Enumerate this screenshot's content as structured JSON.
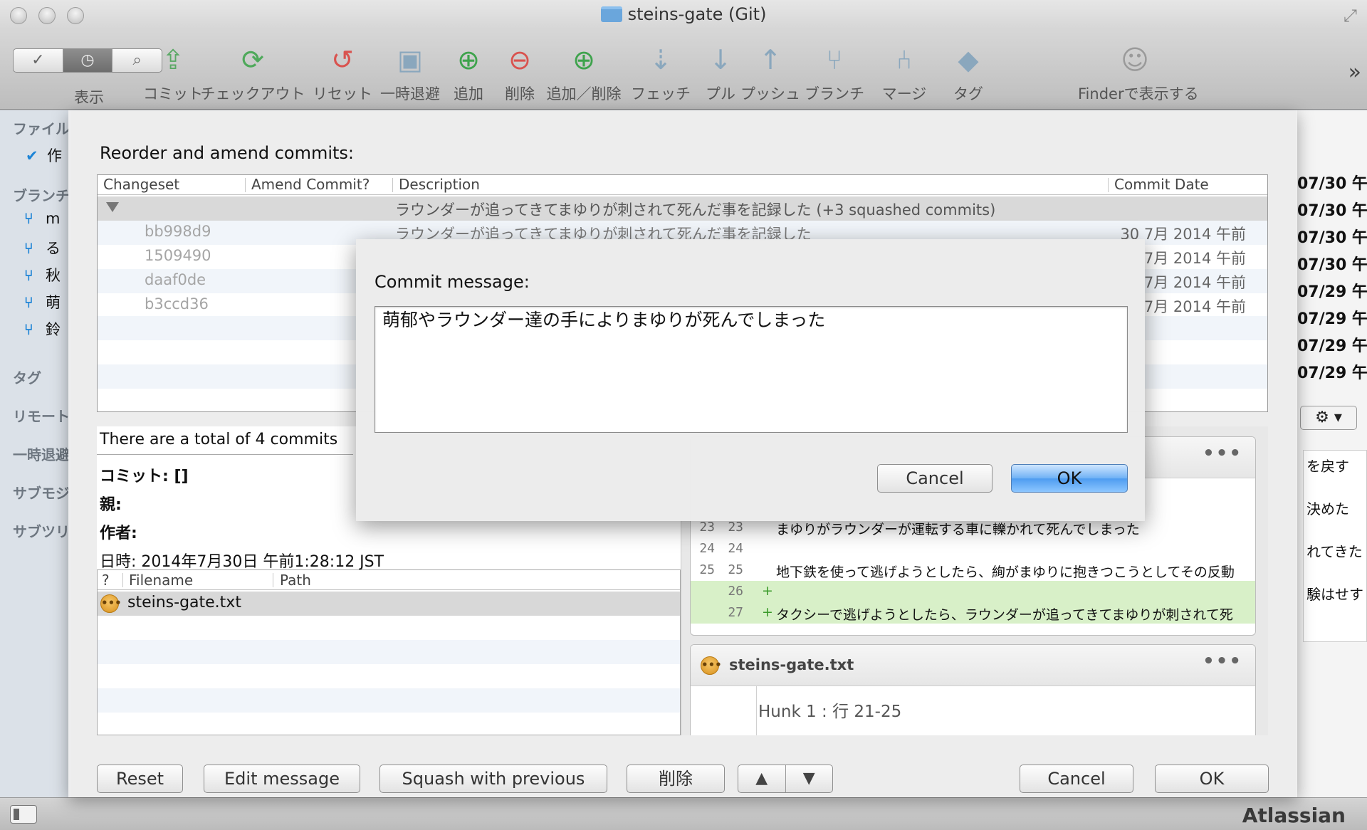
{
  "window": {
    "title": "steins-gate (Git)"
  },
  "toolbar": {
    "view_label": "表示",
    "items": [
      {
        "label": "コミット",
        "icon": "commit-icon",
        "glyph": "⇪",
        "color": "#5aa865"
      },
      {
        "label": "チェックアウト",
        "icon": "checkout-icon",
        "glyph": "⟳",
        "color": "#4fa95b"
      },
      {
        "label": "リセット",
        "icon": "reset-icon",
        "glyph": "↺",
        "color": "#d9534f"
      },
      {
        "label": "一時退避",
        "icon": "stash-icon",
        "glyph": "▣",
        "color": "#8aa7bd"
      },
      {
        "label": "追加",
        "icon": "add-icon",
        "glyph": "⊕",
        "color": "#3fa34d"
      },
      {
        "label": "削除",
        "icon": "remove-icon",
        "glyph": "⊖",
        "color": "#d9534f"
      },
      {
        "label": "追加／削除",
        "icon": "add-remove-icon",
        "glyph": "⊕",
        "color": "#3fa34d"
      },
      {
        "label": "フェッチ",
        "icon": "fetch-icon",
        "glyph": "⇣",
        "color": "#8aa7bd"
      },
      {
        "label": "プル",
        "icon": "pull-icon",
        "glyph": "↓",
        "color": "#8aa7bd"
      },
      {
        "label": "プッシュ",
        "icon": "push-icon",
        "glyph": "↑",
        "color": "#8aa7bd"
      },
      {
        "label": "ブランチ",
        "icon": "branch-icon",
        "glyph": "⑂",
        "color": "#8aa7bd"
      },
      {
        "label": "マージ",
        "icon": "merge-icon",
        "glyph": "⑃",
        "color": "#8aa7bd"
      },
      {
        "label": "タグ",
        "icon": "tag-icon",
        "glyph": "◆",
        "color": "#8aa7bd"
      },
      {
        "label": "Finderで表示する",
        "icon": "finder-icon",
        "glyph": "☺",
        "color": "#9a9a9a"
      }
    ]
  },
  "sidebar": {
    "file_header": "ファイル",
    "file_item": "作",
    "branches_header": "ブランチ",
    "branches": [
      "m",
      "る",
      "秋",
      "萌",
      "鈴"
    ],
    "tags_header": "タグ",
    "remotes_header": "リモート",
    "stash_header": "一時退避",
    "submodules_header": "サブモジ",
    "subtrees_header": "サブツリ"
  },
  "background_right": {
    "dates": [
      "07/30 午",
      "07/30 午",
      "07/30 午",
      "07/30 午",
      "07/29 午",
      "07/29 午",
      "07/29 午",
      "07/29 午"
    ],
    "text_lines": [
      "を戻す",
      "決めた",
      "れてきた",
      "験はせす"
    ]
  },
  "sheet": {
    "title": "Reorder and amend commits:",
    "columns": {
      "changeset": "Changeset",
      "amend": "Amend Commit?",
      "description": "Description",
      "date": "Commit Date"
    },
    "group_row": "ラウンダーが追ってきてまゆりが刺されて死んだ事を記録した (+3 squashed commits)",
    "commits": [
      {
        "hash": "bb998d9",
        "description": "ラウンダーが追ってきてまゆりが刺されて死んだ事を記録した",
        "date": "30 7月 2014 午前"
      },
      {
        "hash": "1509490",
        "description": "",
        "date": "7月 2014 午前"
      },
      {
        "hash": "daaf0de",
        "description": "",
        "date": "7月 2014 午前"
      },
      {
        "hash": "b3ccd36",
        "description": "",
        "date": "7月 2014 午前"
      }
    ],
    "summary_line": "There are a total of 4 commits",
    "meta": {
      "commit": "コミット: []",
      "parent": "親:",
      "author": "作者:",
      "date": "日時: 2014年7月30日 午前1:28:12 JST"
    },
    "files_columns": {
      "status": "?",
      "filename": "Filename",
      "path": "Path"
    },
    "files": [
      {
        "name": "steins-gate.txt"
      }
    ],
    "diff": {
      "card1_lines": [
        {
          "old": "23",
          "new": "23",
          "text": "まゆりがラウンダーが運転する車に轢かれて死んでしまった",
          "added": false
        },
        {
          "old": "24",
          "new": "24",
          "text": "",
          "added": false
        },
        {
          "old": "25",
          "new": "25",
          "text": "地下鉄を使って逃げようとしたら、絢がまゆりに抱きつこうとしてその反動",
          "added": false
        },
        {
          "old": "",
          "new": "26",
          "text": "",
          "added": true
        },
        {
          "old": "",
          "new": "27",
          "text": "タクシーで逃げようとしたら、ラウンダーが追ってきてまゆりが刺されて死",
          "added": true
        }
      ],
      "card2_file": "steins-gate.txt",
      "card2_hunk": "Hunk 1 : 行 21-25"
    },
    "buttons": {
      "reset": "Reset",
      "edit_message": "Edit message",
      "squash": "Squash with previous",
      "delete": "削除",
      "up": "▲",
      "down": "▼",
      "cancel": "Cancel",
      "ok": "OK"
    }
  },
  "dialog": {
    "label": "Commit message:",
    "message": "萌郁やラウンダー達の手によりまゆりが死んでしまった",
    "cancel": "Cancel",
    "ok": "OK"
  },
  "colors": {
    "accent_blue": "#4e9cf0",
    "added_line": "#d8f0c8",
    "branch_icon": "#1d84d6"
  }
}
